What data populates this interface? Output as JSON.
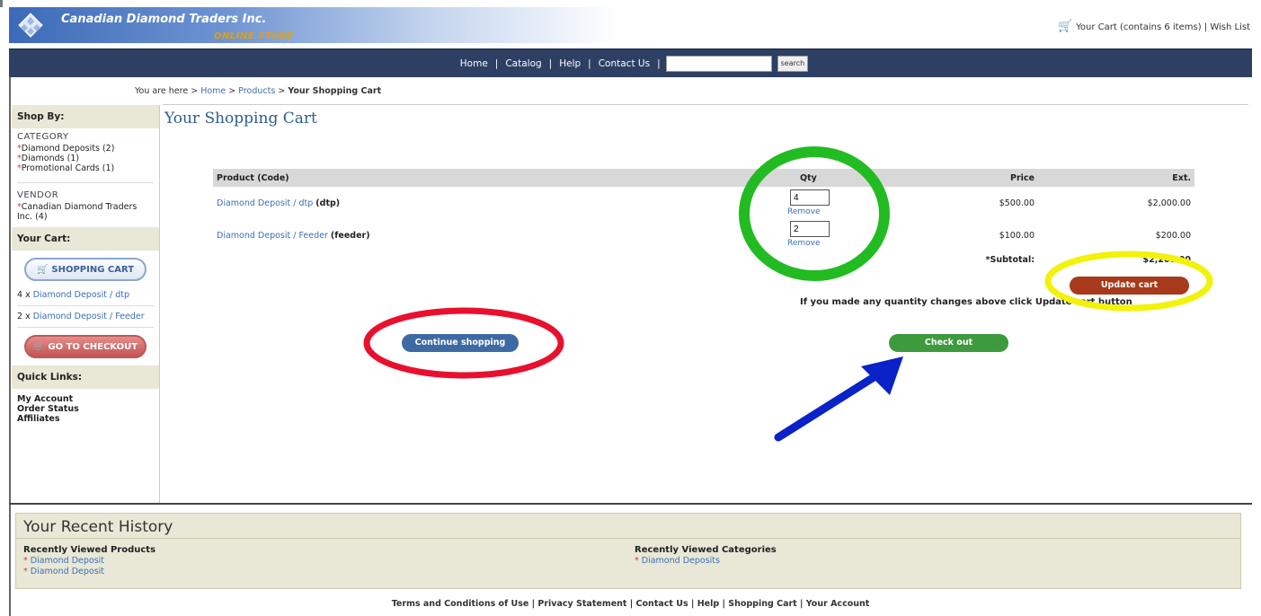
{
  "header": {
    "company": "Canadian Diamond Traders Inc.",
    "store": "ONLINE STORE",
    "cart_link": "Your Cart (contains 6 items) | Wish List"
  },
  "nav": {
    "items": [
      "Home",
      "Catalog",
      "Help",
      "Contact Us"
    ],
    "search_value": "",
    "search_button": "search"
  },
  "breadcrumb": {
    "prefix": "You are here >",
    "home": "Home",
    "products": "Products",
    "current": "Your Shopping Cart",
    "sep": ">"
  },
  "sidebar": {
    "shop_by": "Shop By:",
    "category_label": "CATEGORY",
    "categories": [
      "Diamond Deposits (2)",
      "Diamonds (1)",
      "Promotional Cards (1)"
    ],
    "vendor_label": "VENDOR",
    "vendors": [
      "Canadian Diamond Traders Inc. (4)"
    ],
    "your_cart": "Your Cart:",
    "shopping_cart_btn": "SHOPPING CART",
    "cart_items": [
      {
        "qty": "4 x",
        "name": "Diamond Deposit / dtp"
      },
      {
        "qty": "2 x",
        "name": "Diamond Deposit / Feeder"
      }
    ],
    "checkout_btn": "GO TO CHECKOUT",
    "quick_links": "Quick Links:",
    "quick_items": [
      "My Account",
      "Order Status",
      "Affiliates"
    ]
  },
  "main": {
    "title": "Your Shopping Cart",
    "columns": {
      "product": "Product (Code)",
      "qty": "Qty",
      "price": "Price",
      "ext": "Ext."
    },
    "rows": [
      {
        "product": "Diamond Deposit / dtp",
        "code": "(dtp)",
        "qty": "4",
        "remove": "Remove",
        "price": "$500.00",
        "ext": "$2,000.00"
      },
      {
        "product": "Diamond Deposit / Feeder",
        "code": "(feeder)",
        "qty": "2",
        "remove": "Remove",
        "price": "$100.00",
        "ext": "$200.00"
      }
    ],
    "subtotal_label": "*Subtotal:",
    "subtotal_value": "$2,200.00",
    "update_btn": "Update cart",
    "note": "If you made any quantity changes above click Update cart button",
    "continue_btn": "Continue shopping",
    "checkout_btn": "Check out"
  },
  "history": {
    "title": "Your Recent History",
    "products_head": "Recently Viewed Products",
    "products": [
      "Diamond Deposit",
      "Diamond Deposit"
    ],
    "categories_head": "Recently Viewed Categories",
    "categories": [
      "Diamond Deposits"
    ]
  },
  "footer": {
    "text": "Terms and Conditions of Use | Privacy Statement | Contact Us | Help | Shopping Cart | Your Account"
  },
  "colors": {
    "nav_bg": "#2d3f63",
    "sidebar_head": "#e9e7d6",
    "update_btn": "#a63a1a",
    "continue_btn": "#3e6aa4",
    "checkout_btn": "#3d9a3d",
    "circle_green": "#22bb22",
    "circle_yellow": "#f2f20a",
    "circle_red": "#e8102e",
    "arrow_blue": "#0a22c8"
  }
}
